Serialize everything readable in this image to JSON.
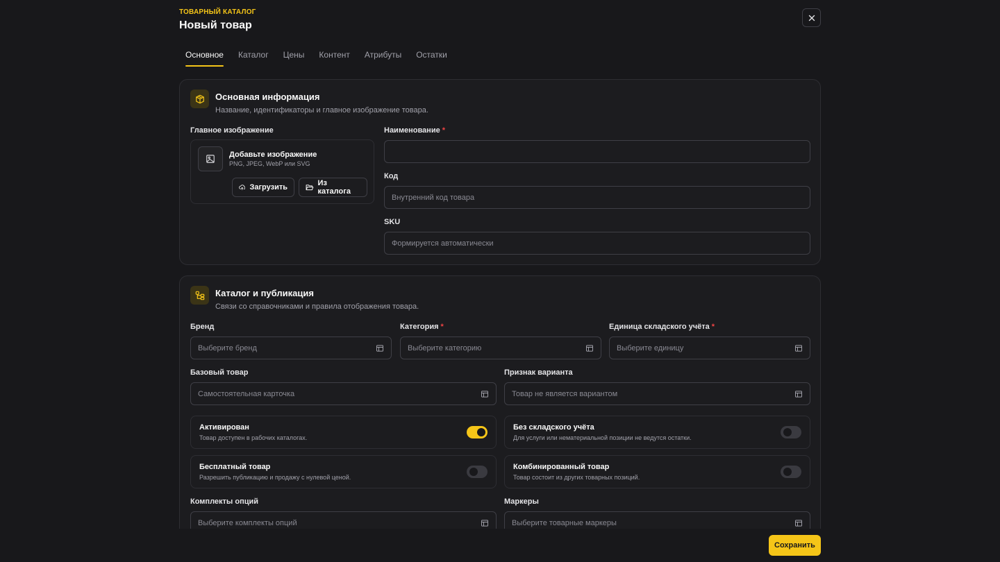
{
  "header": {
    "eyebrow": "ТОВАРНЫЙ КАТАЛОГ",
    "title": "Новый товар"
  },
  "tabs": [
    {
      "label": "Основное",
      "active": true
    },
    {
      "label": "Каталог",
      "active": false
    },
    {
      "label": "Цены",
      "active": false
    },
    {
      "label": "Контент",
      "active": false
    },
    {
      "label": "Атрибуты",
      "active": false
    },
    {
      "label": "Остатки",
      "active": false
    }
  ],
  "basic": {
    "title": "Основная информация",
    "subtitle": "Название, идентификаторы и главное изображение товара.",
    "image_label": "Главное изображение",
    "image_title": "Добавьте изображение",
    "image_formats": "PNG, JPEG, WebP или SVG",
    "upload_label": "Загрузить",
    "from_catalog_label": "Из каталога",
    "name_label": "Наименование",
    "name_value": "",
    "code_label": "Код",
    "code_placeholder": "Внутренний код товара",
    "sku_label": "SKU",
    "sku_placeholder": "Формируется автоматически"
  },
  "catalog": {
    "title": "Каталог и публикация",
    "subtitle": "Связи со справочниками и правила отображения товара.",
    "brand_label": "Бренд",
    "brand_placeholder": "Выберите бренд",
    "category_label": "Категория",
    "category_placeholder": "Выберите категорию",
    "unit_label": "Единица складского учёта",
    "unit_placeholder": "Выберите единицу",
    "base_label": "Базовый товар",
    "base_placeholder": "Самостоятельная карточка",
    "variant_label": "Признак варианта",
    "variant_placeholder": "Товар не является вариантом",
    "toggles": [
      {
        "title": "Активирован",
        "subtitle": "Товар доступен в рабочих каталогах.",
        "on": true
      },
      {
        "title": "Без складского учёта",
        "subtitle": "Для услуги или нематериальной позиции не ведутся остатки.",
        "on": false
      },
      {
        "title": "Бесплатный товар",
        "subtitle": "Разрешить публикацию и продажу с нулевой ценой.",
        "on": false
      },
      {
        "title": "Комбинированный товар",
        "subtitle": "Товар состоит из других товарных позиций.",
        "on": false
      }
    ],
    "options_label": "Комплекты опций",
    "options_placeholder": "Выберите комплекты опций",
    "markers_label": "Маркеры",
    "markers_placeholder": "Выберите товарные маркеры"
  },
  "footer": {
    "save_label": "Сохранить"
  },
  "colors": {
    "accent": "#f5c518",
    "background": "#18181b",
    "required": "#ef4444"
  }
}
